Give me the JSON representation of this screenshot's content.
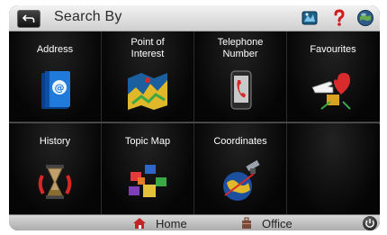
{
  "header": {
    "title": "Search By",
    "back_icon": "back-arrow-icon",
    "map_icon": "map-icon",
    "help_icon": "help-icon",
    "globe_icon": "globe-icon"
  },
  "menu": [
    {
      "label": "Address",
      "icon": "address-book-icon"
    },
    {
      "label": "Point of\nInterest",
      "icon": "poi-map-icon"
    },
    {
      "label": "Telephone\nNumber",
      "icon": "telephone-icon"
    },
    {
      "label": "Favourites",
      "icon": "favourites-icon"
    },
    {
      "label": "History",
      "icon": "hourglass-icon"
    },
    {
      "label": "Topic Map",
      "icon": "topic-map-icon"
    },
    {
      "label": "Coordinates",
      "icon": "satellite-globe-icon"
    }
  ],
  "footer": {
    "home_label": "Home",
    "office_label": "Office",
    "power_icon": "power-icon"
  },
  "colors": {
    "background": "#000000",
    "label": "#ffffff",
    "titlebar": "#d9d9d9"
  }
}
